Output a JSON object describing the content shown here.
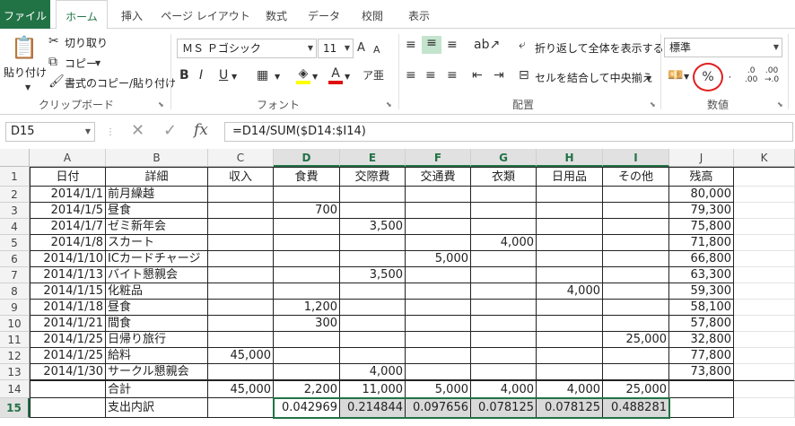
{
  "tabs": [
    "ファイル",
    "ホーム",
    "挿入",
    "ページ レイアウト",
    "数式",
    "データ",
    "校閲",
    "表示"
  ],
  "clipboard": {
    "paste": "貼り付け",
    "cut": "切り取り",
    "copy": "コピー",
    "format_painter": "書式のコピー/貼り付け",
    "group": "クリップボード"
  },
  "font": {
    "name": "ＭＳ Ｐゴシック",
    "size": "11",
    "bold": "B",
    "italic": "I",
    "underline": "U",
    "group": "フォント"
  },
  "alignment": {
    "wrap": "折り返して全体を表示する",
    "merge": "セルを結合して中央揃え",
    "group": "配置"
  },
  "number": {
    "format": "標準",
    "percent": "%",
    "group": "数値"
  },
  "formula_bar": {
    "name_box": "D15",
    "formula": "=D14/SUM($D14:$I14)",
    "fx": "fx"
  },
  "columns": [
    "A",
    "B",
    "C",
    "D",
    "E",
    "F",
    "G",
    "H",
    "I",
    "J",
    "K"
  ],
  "rows": [
    {
      "num": "1",
      "cells": [
        "日付",
        "詳細",
        "収入",
        "食費",
        "交際費",
        "交通費",
        "衣類",
        "日用品",
        "その他",
        "残高",
        ""
      ]
    },
    {
      "num": "2",
      "cells": [
        "2014/1/1",
        "前月繰越",
        "",
        "",
        "",
        "",
        "",
        "",
        "",
        "80,000",
        ""
      ]
    },
    {
      "num": "3",
      "cells": [
        "2014/1/5",
        "昼食",
        "",
        "700",
        "",
        "",
        "",
        "",
        "",
        "79,300",
        ""
      ]
    },
    {
      "num": "4",
      "cells": [
        "2014/1/7",
        "ゼミ新年会",
        "",
        "",
        "3,500",
        "",
        "",
        "",
        "",
        "75,800",
        ""
      ]
    },
    {
      "num": "5",
      "cells": [
        "2014/1/8",
        "スカート",
        "",
        "",
        "",
        "",
        "4,000",
        "",
        "",
        "71,800",
        ""
      ]
    },
    {
      "num": "6",
      "cells": [
        "2014/1/10",
        "ICカードチャージ",
        "",
        "",
        "",
        "5,000",
        "",
        "",
        "",
        "66,800",
        ""
      ]
    },
    {
      "num": "7",
      "cells": [
        "2014/1/13",
        "バイト懇親会",
        "",
        "",
        "3,500",
        "",
        "",
        "",
        "",
        "63,300",
        ""
      ]
    },
    {
      "num": "8",
      "cells": [
        "2014/1/15",
        "化粧品",
        "",
        "",
        "",
        "",
        "",
        "4,000",
        "",
        "59,300",
        ""
      ]
    },
    {
      "num": "9",
      "cells": [
        "2014/1/18",
        "昼食",
        "",
        "1,200",
        "",
        "",
        "",
        "",
        "",
        "58,100",
        ""
      ]
    },
    {
      "num": "10",
      "cells": [
        "2014/1/21",
        "間食",
        "",
        "300",
        "",
        "",
        "",
        "",
        "",
        "57,800",
        ""
      ]
    },
    {
      "num": "11",
      "cells": [
        "2014/1/25",
        "日帰り旅行",
        "",
        "",
        "",
        "",
        "",
        "",
        "25,000",
        "32,800",
        ""
      ]
    },
    {
      "num": "12",
      "cells": [
        "2014/1/25",
        "給料",
        "45,000",
        "",
        "",
        "",
        "",
        "",
        "",
        "77,800",
        ""
      ]
    },
    {
      "num": "13",
      "cells": [
        "2014/1/30",
        "サークル懇親会",
        "",
        "",
        "4,000",
        "",
        "",
        "",
        "",
        "73,800",
        ""
      ]
    },
    {
      "num": "14",
      "cells": [
        "",
        "合計",
        "45,000",
        "2,200",
        "11,000",
        "5,000",
        "4,000",
        "4,000",
        "25,000",
        "",
        ""
      ]
    },
    {
      "num": "15",
      "cells": [
        "",
        "支出内訳",
        "",
        "0.042969",
        "0.214844",
        "0.097656",
        "0.078125",
        "0.078125",
        "0.488281",
        "",
        ""
      ]
    }
  ]
}
